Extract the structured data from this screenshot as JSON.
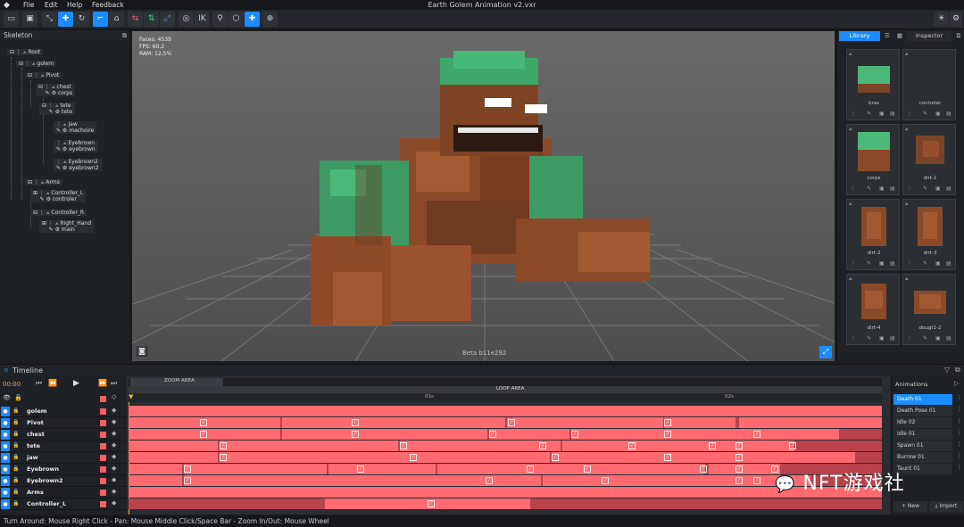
{
  "window": {
    "title": "Earth Golem Animation v2.vxr"
  },
  "menu": [
    "File",
    "Edit",
    "Help",
    "Feedback"
  ],
  "toolbar": {
    "ik_label": "IK"
  },
  "skeleton": {
    "title": "Skeleton",
    "nodes": [
      {
        "label": "Root"
      },
      {
        "label": "golem"
      },
      {
        "label": "Pivot"
      },
      {
        "label": "chest",
        "sub": "corps"
      },
      {
        "label": "tete",
        "sub": "tete"
      },
      {
        "label": "jaw",
        "sub": "machoire"
      },
      {
        "label": "Eyebrown",
        "sub": "eyebrown"
      },
      {
        "label": "Eyebrown2",
        "sub": "eyebrown2"
      },
      {
        "label": "Arms"
      },
      {
        "label": "Controller_L",
        "sub": "controler"
      },
      {
        "label": "Controller_R"
      },
      {
        "label": "Right_Hand",
        "sub": "main"
      }
    ]
  },
  "viewport": {
    "faces": "Faces: 4539",
    "fps": "FPS: 60,2",
    "ram": "RAM: 12,5%",
    "beta": "Beta b11e292"
  },
  "library": {
    "tabs": [
      "Library",
      "Inspector"
    ],
    "items": [
      "bras",
      "controler",
      "corps",
      "dirt-1",
      "dirt-2",
      "dirt-3",
      "dirt-4",
      "dougt1-2"
    ]
  },
  "timeline": {
    "title": "Timeline",
    "time": "00:00",
    "zoom_label": "ZOOM AREA",
    "loop_label": "LOOP AREA",
    "ruler": [
      "01s",
      "02s"
    ],
    "tracks": [
      "golem",
      "Pivot",
      "chest",
      "tete",
      "jaw",
      "Eyebrown",
      "Eyebrown2",
      "Arms",
      "Controller_L"
    ]
  },
  "animations": {
    "title": "Animations",
    "items": [
      "Death 01",
      "Death Pose 01",
      "Idle 02",
      "Idle 01",
      "Spawn 01",
      "Burrow 01",
      "Taunt 01"
    ],
    "selected": 0,
    "new_label": "New",
    "import_label": "Import"
  },
  "status": "Turn Around: Mouse Right Click - Pan: Mouse Middle Click/Space Bar - Zoom In/Out: Mouse Wheel",
  "watermark": "NFT游戏社",
  "colors": {
    "accent": "#1a8cff",
    "keyframe": "#ff6b70",
    "golem_green": "#3aa86a",
    "golem_brown": "#8a4a2a"
  }
}
